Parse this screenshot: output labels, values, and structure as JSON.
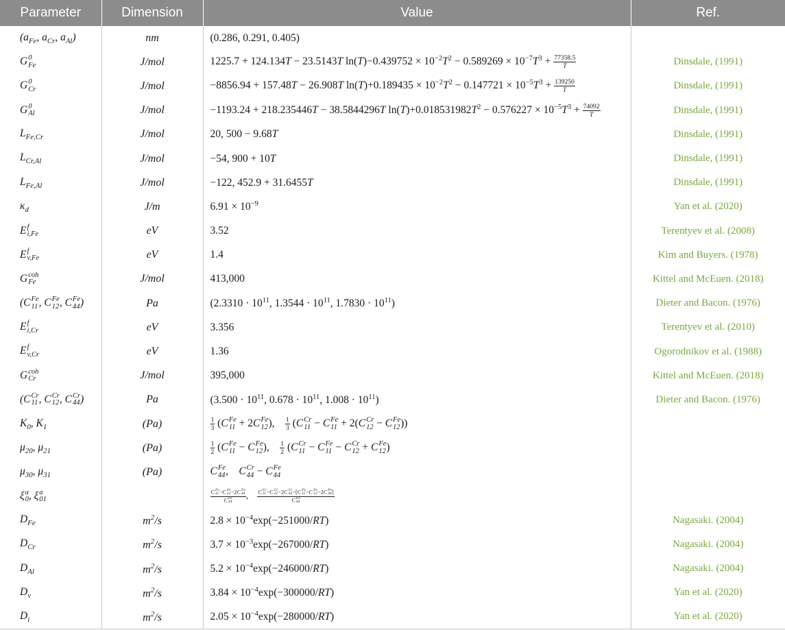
{
  "header": {
    "parameter": "Parameter",
    "dimension": "Dimension",
    "value": "Value",
    "ref": "Ref."
  },
  "rows": [
    {
      "parameter": "(aFe, aCr, aAl)",
      "dimension": "nm",
      "value": "(0.286, 0.291, 0.405)",
      "ref": ""
    },
    {
      "parameter": "G0Fe",
      "dimension": "J/mol",
      "value": "1225.7 + 124.134T − 23.5143T ln(T)−0.439752 × 10−2 T2 − 0.589269 × 10−7 T3 + 77358.5/T",
      "ref": "Dinsdale, (1991)"
    },
    {
      "parameter": "G0Cr",
      "dimension": "J/mol",
      "value": "−8856.94 + 157.48T − 26.908T ln(T)+0.189435 × 10−2 T2 − 0.147721 × 10−5 T3 + 139250/T",
      "ref": "Dinsdale, (1991)"
    },
    {
      "parameter": "G0Al",
      "dimension": "J/mol",
      "value": "−1193.24 + 218.235446T − 38.5844296T ln(T)+0.0185319827T2 − 0.576227 × 10−5 T3 + 74092/T",
      "ref": "Dinsdale, (1991)"
    },
    {
      "parameter": "LFe,Cr",
      "dimension": "J/mol",
      "value": "20,500 − 9.68T",
      "ref": "Dinsdale, (1991)"
    },
    {
      "parameter": "LCr,Al",
      "dimension": "J/mol",
      "value": "−54,900 + 10T",
      "ref": "Dinsdale, (1991)"
    },
    {
      "parameter": "LFe,Al",
      "dimension": "J/mol",
      "value": "−122, 452.9 + 31.6455T",
      "ref": "Dinsdale, (1991)"
    },
    {
      "parameter": "κd",
      "dimension": "J/m",
      "value": "6.91 × 10−9",
      "ref": "Yan et al. (2020)"
    },
    {
      "parameter": "Efi,Fe",
      "dimension": "eV",
      "value": "3.52",
      "ref": "Terentyev et al. (2008)"
    },
    {
      "parameter": "Efv,Fe",
      "dimension": "eV",
      "value": "1.4",
      "ref": "Kim and Buyers. (1978)"
    },
    {
      "parameter": "GcohFe",
      "dimension": "J/mol",
      "value": "413,000",
      "ref": "Kittel and McEuen. (2018)"
    },
    {
      "parameter": "(CFe11, CFe12, CFe44)",
      "dimension": "Pa",
      "value": "(2.3310 · 1011, 1.3544 · 1011, 1.7830 · 1011)",
      "ref": "Dieter and Bacon. (1976)"
    },
    {
      "parameter": "Efi,Cr",
      "dimension": "eV",
      "value": "3.356",
      "ref": "Terentyev et al. (2010)"
    },
    {
      "parameter": "Efv,Cr",
      "dimension": "eV",
      "value": "1.36",
      "ref": "Ogorodnikov et al. (1988)"
    },
    {
      "parameter": "GcohCr",
      "dimension": "J/mol",
      "value": "395,000",
      "ref": "Kittel and McEuen. (2018)"
    },
    {
      "parameter": "(CCr11, CCr12, CCr44)",
      "dimension": "Pa",
      "value": "(3.500 · 1011, 0.678 · 1011, 1.008 · 1011)",
      "ref": "Dieter and Bacon. (1976)"
    },
    {
      "parameter": "K0, K1",
      "dimension": "(Pa)",
      "value": "1/3 (CFe11 + 2CFe12), 1/3 (CCr11 − CFe11 + 2(CCr12 − CFe12))",
      "ref": ""
    },
    {
      "parameter": "μ20, μ21",
      "dimension": "(Pa)",
      "value": "1/2 (CFe11 − CFe12), 1/2 (CCr11 − CFe11 − CCr12 + CFe12)",
      "ref": ""
    },
    {
      "parameter": "μ30, μ31",
      "dimension": "(Pa)",
      "value": "CFe44, CCr44 − CFe44",
      "ref": ""
    },
    {
      "parameter": "ξa0, ξa01",
      "dimension": "",
      "value": "(CFe11−CFe12−2CFe44)/CFe44, (CCr11−CCr12−2CCr44−[CFe11−CFe12−2CFe44])/CFe44",
      "ref": ""
    },
    {
      "parameter": "DFe",
      "dimension": "m2/s",
      "value": "2.8 × 10−4 exp(−251000/RT)",
      "ref": "Nagasaki. (2004)"
    },
    {
      "parameter": "DCr",
      "dimension": "m2/s",
      "value": "3.7 × 10−3 exp(−267000/RT)",
      "ref": "Nagasaki. (2004)"
    },
    {
      "parameter": "DAl",
      "dimension": "m2/s",
      "value": "5.2 × 10−4 exp(−246000/RT)",
      "ref": "Nagasaki. (2004)"
    },
    {
      "parameter": "Dv",
      "dimension": "m2/s",
      "value": "3.84 × 10−4 exp(−300000/RT)",
      "ref": "Yan et al. (2020)"
    },
    {
      "parameter": "Di",
      "dimension": "m2/s",
      "value": "2.05 × 10−4 exp(−280000/RT)",
      "ref": "Yan et al. (2020)"
    }
  ],
  "colors": {
    "header_bg": "#8c8c8c",
    "header_text": "#ffffff",
    "ref_text": "#78a83c",
    "grid": "#c8c8c8"
  }
}
